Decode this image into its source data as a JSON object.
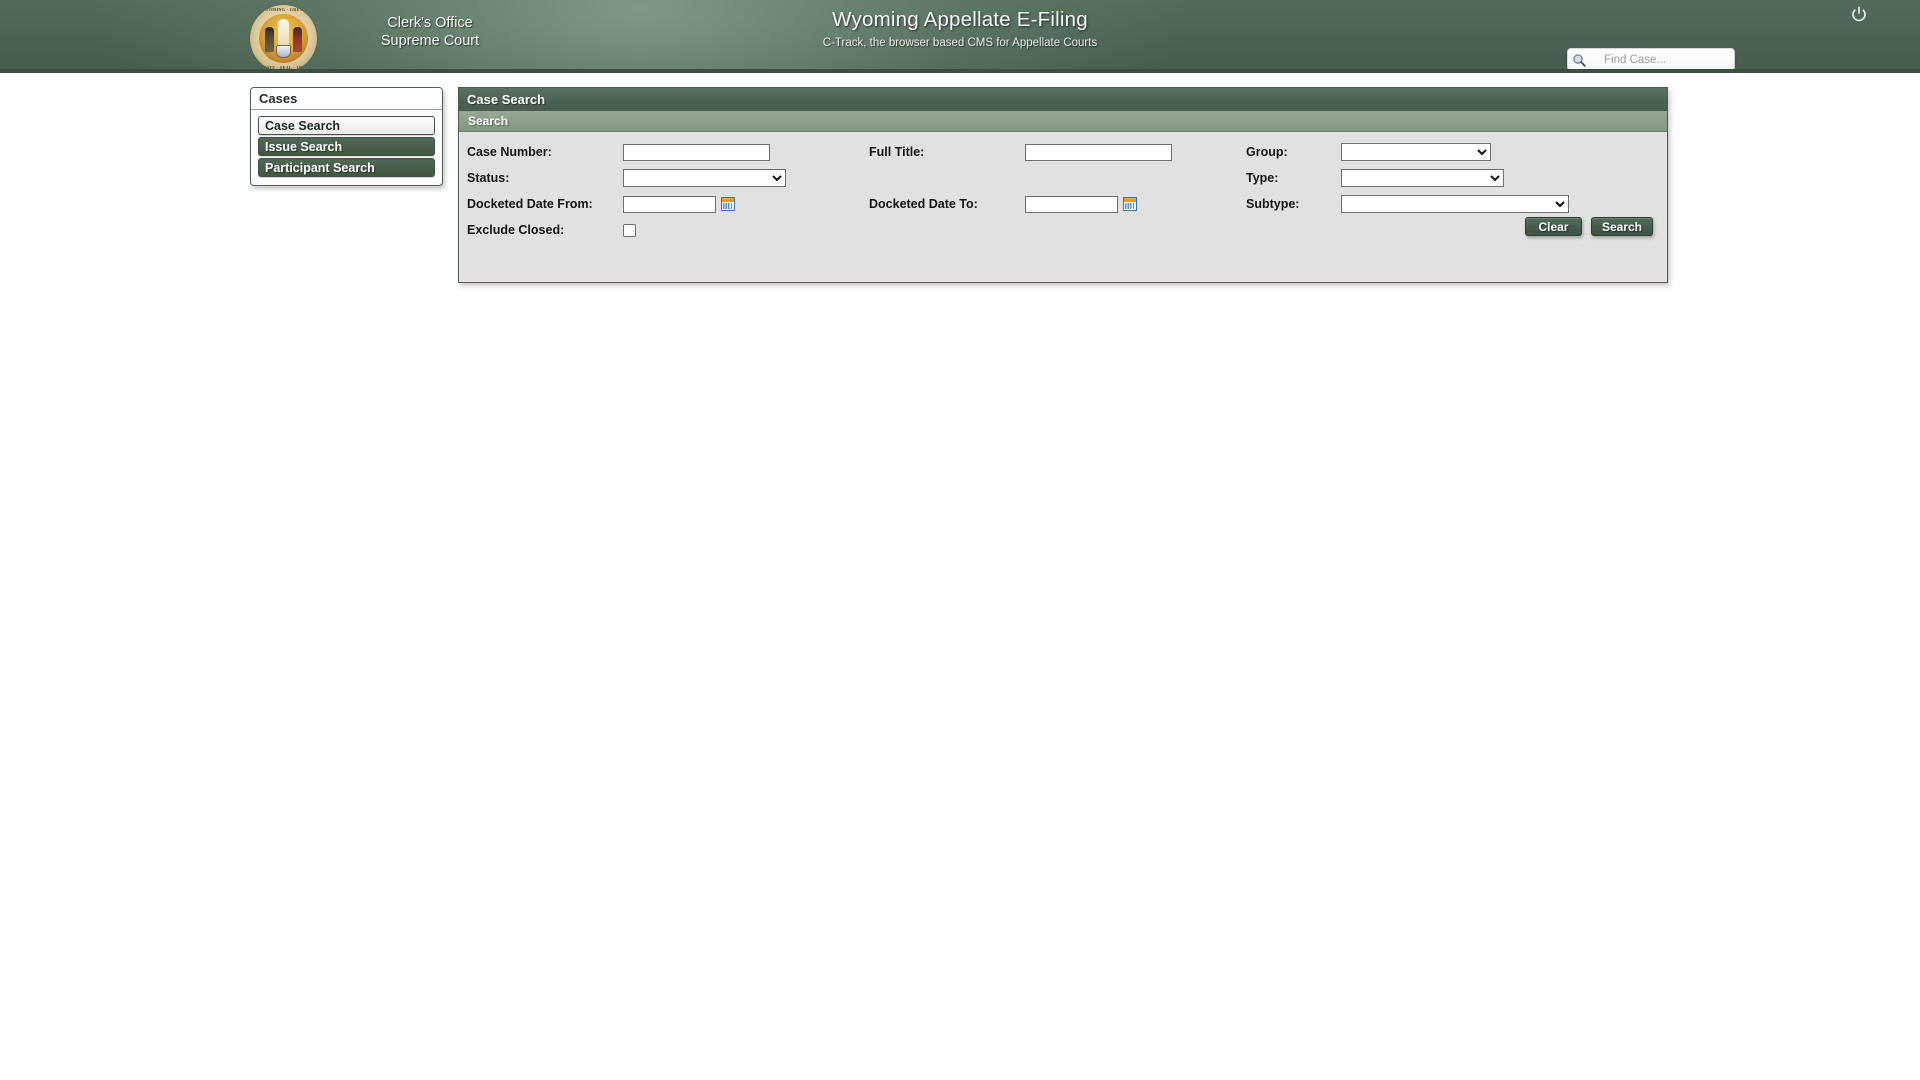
{
  "header": {
    "court_line_1": "Clerk's Office",
    "court_line_2": "Supreme Court",
    "title": "Wyoming Appellate E-Filing",
    "subtitle": "C-Track, the browser based CMS for Appellate Courts",
    "seal_ring_top": "· WYOMING · GREAT ·",
    "seal_ring_bottom": "· STATE · SEAL · 1890 ·",
    "logout_icon": "power-icon",
    "search_icon": "magnifier-icon",
    "find_case_value": "",
    "find_case_placeholder": "Find Case..."
  },
  "sidebar": {
    "header": "Cases",
    "items": [
      {
        "label": "Case Search",
        "state": "selected"
      },
      {
        "label": "Issue Search",
        "state": "normal"
      },
      {
        "label": "Participant Search",
        "state": "normal"
      }
    ]
  },
  "main": {
    "panel_title": "Case Search",
    "section_title": "Search",
    "fields": {
      "case_number": {
        "label": "Case Number:",
        "value": ""
      },
      "status": {
        "label": "Status:",
        "value": "",
        "options": [
          ""
        ]
      },
      "docketed_date_from": {
        "label": "Docketed Date From:",
        "value": "",
        "calendar_icon": "calendar-icon"
      },
      "exclude_closed": {
        "label": "Exclude Closed:",
        "checked": false
      },
      "full_title": {
        "label": "Full Title:",
        "value": ""
      },
      "docketed_date_to": {
        "label": "Docketed Date To:",
        "value": "",
        "calendar_icon": "calendar-icon"
      },
      "group": {
        "label": "Group:",
        "value": "",
        "options": [
          ""
        ]
      },
      "type": {
        "label": "Type:",
        "value": "",
        "options": [
          ""
        ]
      },
      "subtype": {
        "label": "Subtype:",
        "value": "",
        "options": [
          ""
        ]
      }
    },
    "buttons": {
      "clear": "Clear",
      "search": "Search"
    }
  },
  "colors": {
    "header_green": "#4b6353",
    "panel_title_green": "#4c6353",
    "section_sage": "#8ba089",
    "form_bg": "#e1e1e1",
    "button_green": "#465c4d",
    "calendar_orange": "#e4901c",
    "calendar_blue": "#2f77b5"
  }
}
